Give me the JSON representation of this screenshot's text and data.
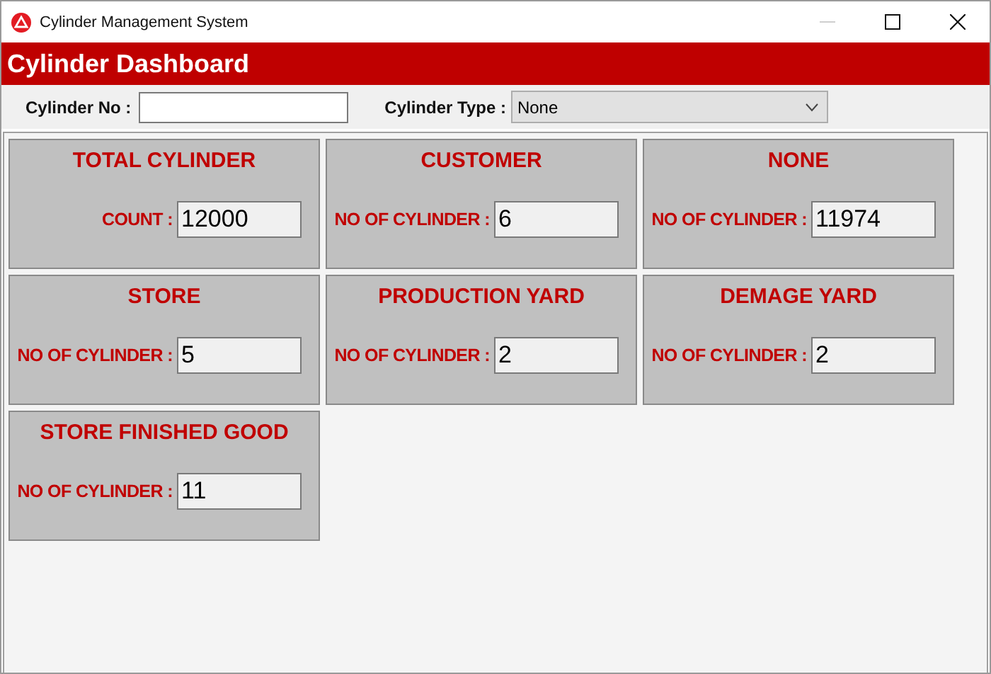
{
  "window": {
    "title": "Cylinder Management System",
    "minimize_disabled": true
  },
  "header": {
    "title": "Cylinder Dashboard"
  },
  "filters": {
    "cylinder_no": {
      "label": "Cylinder No :"
    },
    "cylinder_type": {
      "label": "Cylinder Type :",
      "value": "None"
    }
  },
  "cards": [
    {
      "title": "TOTAL CYLINDER",
      "label": "COUNT :",
      "value": "12000"
    },
    {
      "title": "CUSTOMER",
      "label": "NO OF CYLINDER :",
      "value": "6"
    },
    {
      "title": "NONE",
      "label": "NO OF CYLINDER :",
      "value": "11974"
    },
    {
      "title": "STORE",
      "label": "NO OF CYLINDER :",
      "value": "5"
    },
    {
      "title": "PRODUCTION YARD",
      "label": "NO OF CYLINDER :",
      "value": "2"
    },
    {
      "title": "DEMAGE YARD",
      "label": "NO OF CYLINDER :",
      "value": "2"
    },
    {
      "title": "STORE FINISHED GOOD",
      "label": "NO OF CYLINDER :",
      "value": "11"
    }
  ]
}
